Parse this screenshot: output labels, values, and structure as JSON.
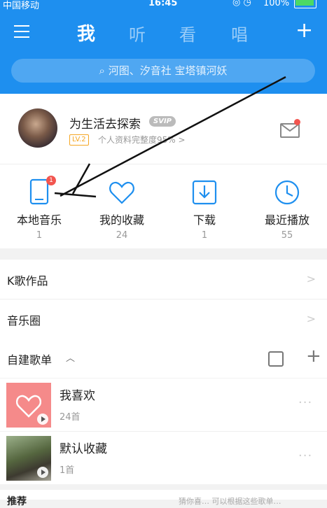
{
  "status_bar": {
    "carrier": "中国移动",
    "time": "16:45",
    "battery": "100%"
  },
  "header": {
    "tabs": [
      "我",
      "听",
      "看",
      "唱"
    ],
    "active_tab": "我",
    "search_placeholder": "河图、汐音社 宝塔镇河妖",
    "accent_color": "#1e8fef"
  },
  "profile": {
    "username": "为生活去探索",
    "vip_badge": "SVIP",
    "level": "LV.2",
    "completion_text": "个人资料完整度95% >"
  },
  "quick_actions": [
    {
      "label": "本地音乐",
      "count": "1",
      "icon": "phone-icon",
      "badge": "1"
    },
    {
      "label": "我的收藏",
      "count": "24",
      "icon": "heart-icon"
    },
    {
      "label": "下载",
      "count": "1",
      "icon": "download-icon"
    },
    {
      "label": "最近播放",
      "count": "55",
      "icon": "clock-icon"
    }
  ],
  "rows": {
    "k_song": "K歌作品",
    "music_circle": "音乐圈"
  },
  "playlists_section": {
    "title": "自建歌单",
    "items": [
      {
        "name": "我喜欢",
        "count": "24首"
      },
      {
        "name": "默认收藏",
        "count": "1首"
      }
    ]
  },
  "bottom_partial": {
    "title": "推荐",
    "right": "猜你喜…  可以根据这些歌单…"
  }
}
